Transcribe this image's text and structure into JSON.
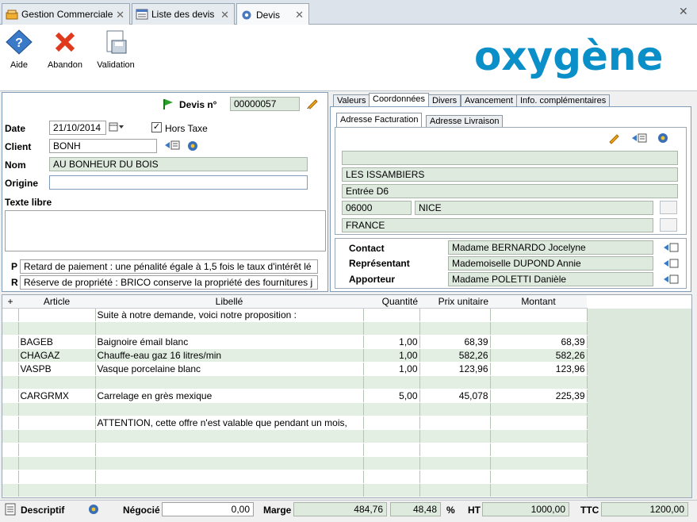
{
  "tabs": [
    {
      "label": "Gestion Commerciale",
      "icon": "register-icon"
    },
    {
      "label": "Liste des devis",
      "icon": "list-icon"
    },
    {
      "label": "Devis",
      "icon": "gear-icon"
    }
  ],
  "toolbar": {
    "help": "Aide",
    "abort": "Abandon",
    "validate": "Validation"
  },
  "logo": "oxygène",
  "header": {
    "devis_label": "Devis n°",
    "devis_num": "00000057",
    "date_label": "Date",
    "date": "21/10/2014",
    "hors_taxe": "Hors Taxe",
    "client_label": "Client",
    "client": "BONH",
    "nom_label": "Nom",
    "nom": "AU BONHEUR DU BOIS",
    "origine_label": "Origine",
    "origine": "",
    "texte_label": "Texte libre",
    "texte": "",
    "p_label": "P",
    "p_text": "Retard de paiement : une pénalité égale à 1,5 fois le taux d'intérêt lé",
    "r_label": "R",
    "r_text": "Réserve de propriété : BRICO conserve la propriété des fournitures j"
  },
  "right_tabs": [
    "Valeurs",
    "Coordonnées",
    "Divers",
    "Avancement",
    "Info. complémentaires"
  ],
  "addr_tabs": [
    "Adresse Facturation",
    "Adresse Livraison"
  ],
  "address": {
    "line0": "",
    "line1": "LES ISSAMBIERS",
    "line2": "Entrée D6",
    "cp": "06000",
    "ville": "NICE",
    "pays": "FRANCE"
  },
  "contacts": [
    {
      "label": "Contact",
      "value": "Madame BERNARDO Jocelyne"
    },
    {
      "label": "Représentant",
      "value": "Mademoiselle DUPOND Annie"
    },
    {
      "label": "Apporteur",
      "value": "Madame POLETTI Danièle"
    }
  ],
  "grid": {
    "headers": [
      "Article",
      "Libellé",
      "Quantité",
      "Prix unitaire",
      "Montant"
    ],
    "rows": [
      [
        "",
        "Suite à notre demande, voici notre proposition :",
        "",
        "",
        ""
      ],
      [
        "",
        "",
        "",
        "",
        ""
      ],
      [
        "BAGEB",
        "Baignoire émail blanc",
        "1,00",
        "68,39",
        "68,39"
      ],
      [
        "CHAGAZ",
        "Chauffe-eau gaz 16 litres/min",
        "1,00",
        "582,26",
        "582,26"
      ],
      [
        "VASPB",
        "Vasque porcelaine blanc",
        "1,00",
        "123,96",
        "123,96"
      ],
      [
        "",
        "",
        "",
        "",
        ""
      ],
      [
        "CARGRMX",
        "Carrelage en grès mexique",
        "5,00",
        "45,078",
        "225,39"
      ],
      [
        "",
        "",
        "",
        "",
        ""
      ],
      [
        "",
        "ATTENTION, cette offre n'est valable que pendant un mois,",
        "",
        "",
        ""
      ],
      [
        "",
        "",
        "",
        "",
        ""
      ],
      [
        "",
        "",
        "",
        "",
        ""
      ],
      [
        "",
        "",
        "",
        "",
        ""
      ],
      [
        "",
        "",
        "",
        "",
        ""
      ],
      [
        "",
        "",
        "",
        "",
        ""
      ]
    ]
  },
  "footer": {
    "descriptif": "Descriptif",
    "negocie_label": "Négocié",
    "negocie": "0,00",
    "marge_label": "Marge",
    "marge": "484,76",
    "marge_pct": "48,48",
    "pct": "%",
    "ht_label": "HT",
    "ht": "1000,00",
    "ttc_label": "TTC",
    "ttc": "1200,00"
  }
}
